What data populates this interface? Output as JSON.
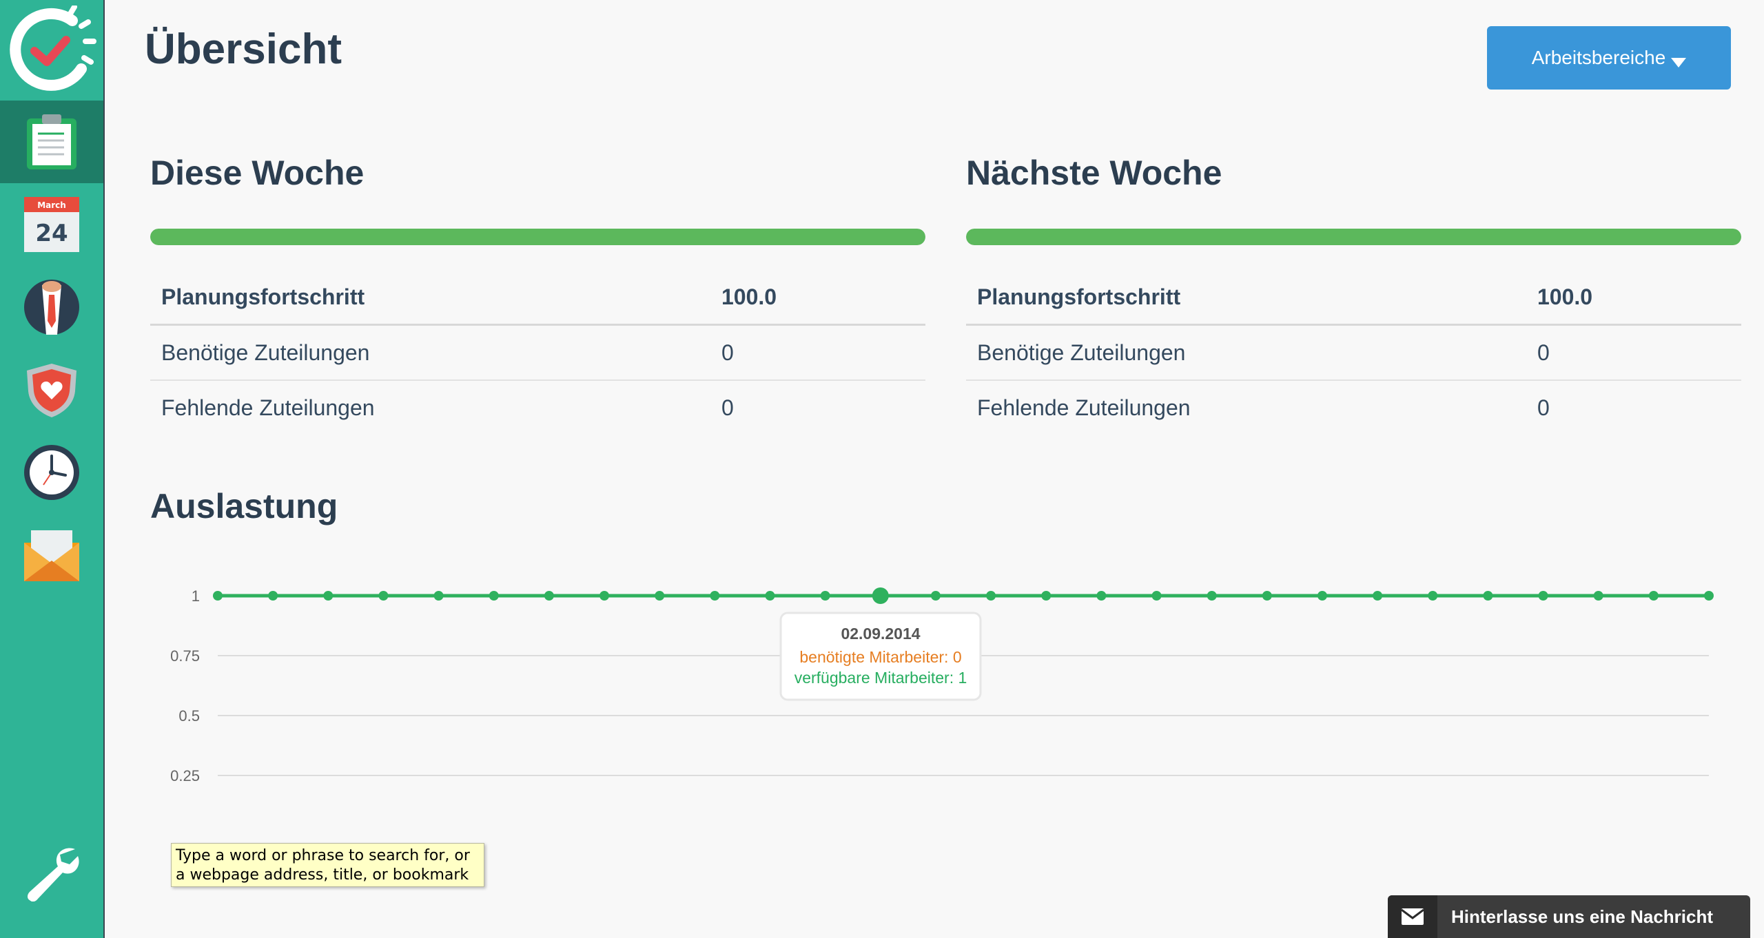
{
  "app": {
    "page_title": "Übersicht",
    "workspace_button": "Arbeitsbereiche"
  },
  "sidebar": {
    "items": [
      {
        "name": "dashboard",
        "icon": "clipboard-icon",
        "active": true
      },
      {
        "name": "calendar",
        "icon": "calendar-icon",
        "month": "March",
        "day": "24"
      },
      {
        "name": "employees",
        "icon": "employee-icon"
      },
      {
        "name": "health",
        "icon": "shield-heart-icon"
      },
      {
        "name": "time",
        "icon": "clock-icon"
      },
      {
        "name": "messages",
        "icon": "envelope-icon"
      }
    ],
    "settings_icon": "wrench-icon"
  },
  "this_week": {
    "title": "Diese Woche",
    "progress": 1.0,
    "rows": [
      {
        "label": "Planungsfortschritt",
        "value": "100.0"
      },
      {
        "label": "Benötige Zuteilungen",
        "value": "0"
      },
      {
        "label": "Fehlende Zuteilungen",
        "value": "0"
      }
    ]
  },
  "next_week": {
    "title": "Nächste Woche",
    "progress": 1.0,
    "rows": [
      {
        "label": "Planungsfortschritt",
        "value": "100.0"
      },
      {
        "label": "Benötige Zuteilungen",
        "value": "0"
      },
      {
        "label": "Fehlende Zuteilungen",
        "value": "0"
      }
    ]
  },
  "utilization": {
    "title": "Auslastung"
  },
  "chart_data": {
    "type": "line",
    "title": "",
    "xlabel": "",
    "ylabel": "",
    "grid": true,
    "y_ticks": [
      "1",
      "0.75",
      "0.5",
      "0.25"
    ],
    "y_tick_values": [
      1,
      0.75,
      0.5,
      0.25
    ],
    "ylim": [
      0,
      1
    ],
    "series": [
      {
        "values": [
          1,
          1,
          1,
          1,
          1,
          1,
          1,
          1,
          1,
          1,
          1,
          1,
          1,
          1,
          1,
          1,
          1,
          1,
          1,
          1,
          1,
          1,
          1,
          1,
          1,
          1,
          1,
          1
        ],
        "color": "#2fb15e"
      }
    ],
    "highlight_index": 12,
    "tooltip": {
      "date": "02.09.2014",
      "needed": "benötigte Mitarbeiter: 0",
      "available": "verfügbare Mitarbeiter: 1",
      "needed_color": "#e67e22",
      "available_color": "#27ae60"
    }
  },
  "browser_tooltip": "Type a word or phrase to search for, or a webpage address, title, or bookmark",
  "chat": {
    "label": "Hinterlasse uns eine Nachricht",
    "icon": "envelope-icon"
  },
  "colors": {
    "sidebar": "#2fb496",
    "sidebar_active": "#1e7d67",
    "accent_button": "#3a96d9",
    "progress": "#5cb85c",
    "heading": "#2c3e50"
  }
}
